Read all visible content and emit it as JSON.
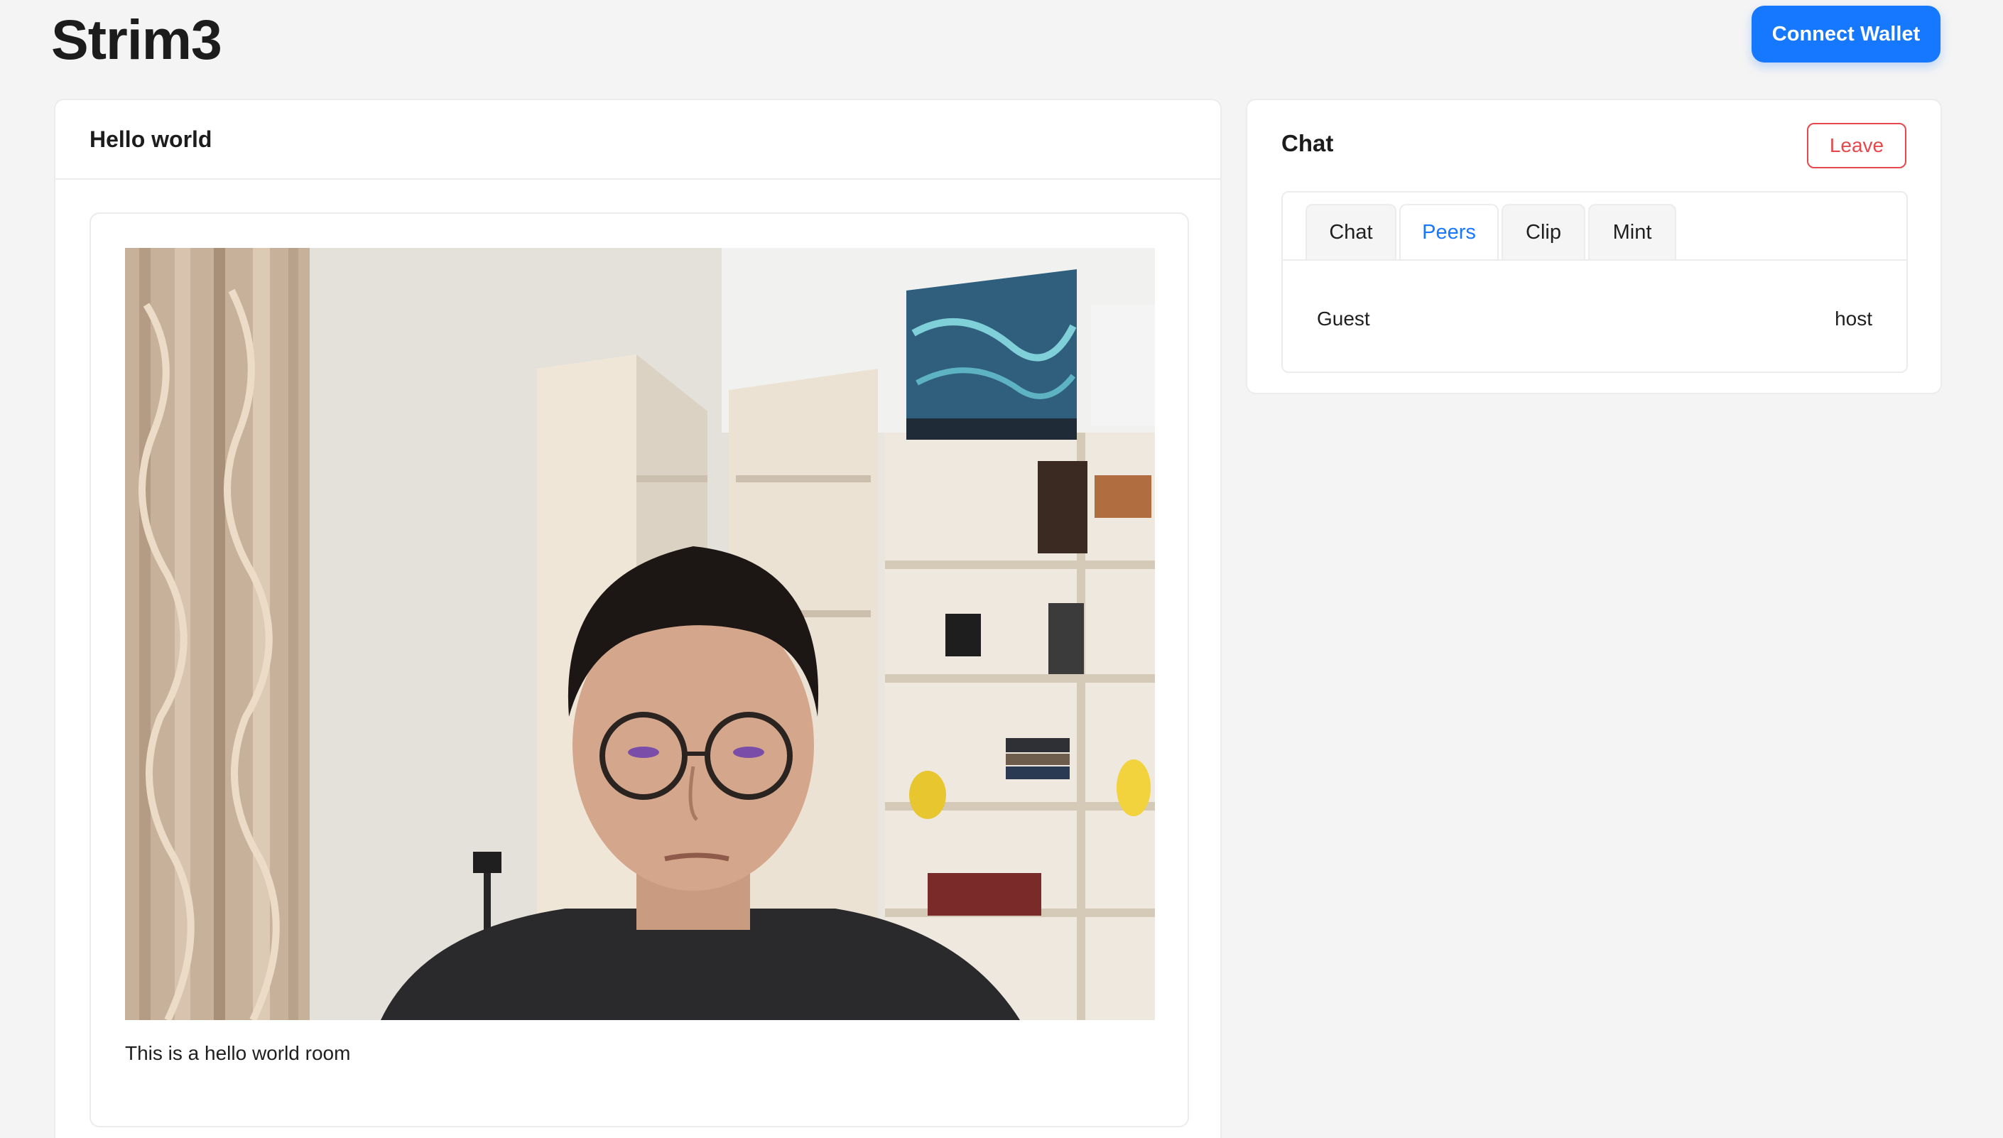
{
  "header": {
    "app_title": "Strim3",
    "connect_wallet_label": "Connect Wallet",
    "accent_color": "#1677ff"
  },
  "room": {
    "title": "Hello world",
    "description": "This is a hello world room",
    "video_feed": "webcam-video"
  },
  "chat_panel": {
    "title": "Chat",
    "leave_label": "Leave",
    "leave_color": "#e5484d",
    "tabs": [
      {
        "label": "Chat",
        "active": false
      },
      {
        "label": "Peers",
        "active": true
      },
      {
        "label": "Clip",
        "active": false
      },
      {
        "label": "Mint",
        "active": false
      }
    ],
    "peers": [
      {
        "name": "Guest",
        "role": "host"
      }
    ]
  }
}
